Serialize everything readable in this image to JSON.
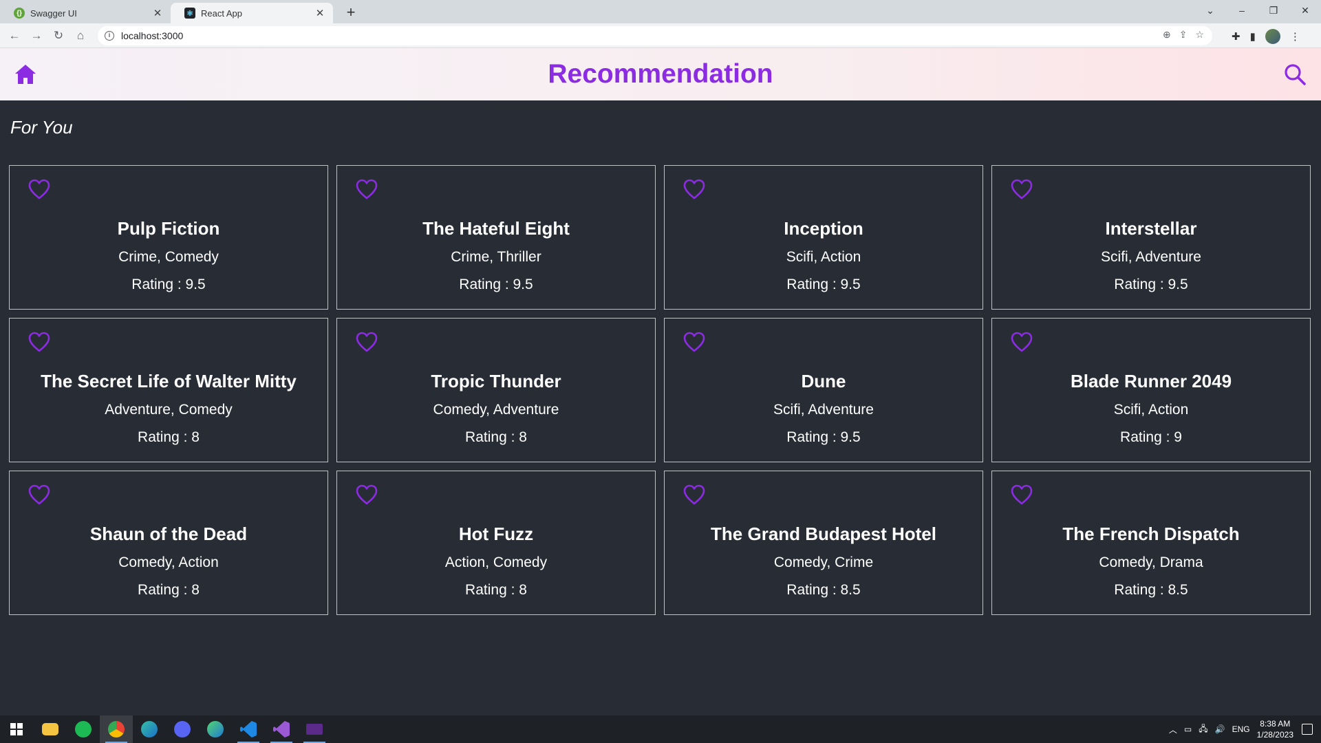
{
  "browser": {
    "tabs": [
      {
        "title": "Swagger UI",
        "active": false
      },
      {
        "title": "React App",
        "active": true
      }
    ],
    "new_tab_label": "+",
    "address": "localhost:3000",
    "window_controls": [
      "⌄",
      "–",
      "❐",
      "✕"
    ]
  },
  "app": {
    "title": "Recommendation",
    "accent_color": "#8b2be2",
    "section_title": "For You",
    "movies": [
      {
        "title": "Pulp Fiction",
        "genres": "Crime, Comedy",
        "rating": "Rating : 9.5"
      },
      {
        "title": "The Hateful Eight",
        "genres": "Crime, Thriller",
        "rating": "Rating : 9.5"
      },
      {
        "title": "Inception",
        "genres": "Scifi, Action",
        "rating": "Rating : 9.5"
      },
      {
        "title": "Interstellar",
        "genres": "Scifi, Adventure",
        "rating": "Rating : 9.5"
      },
      {
        "title": "The Secret Life of Walter Mitty",
        "genres": "Adventure, Comedy",
        "rating": "Rating : 8"
      },
      {
        "title": "Tropic Thunder",
        "genres": "Comedy, Adventure",
        "rating": "Rating : 8"
      },
      {
        "title": "Dune",
        "genres": "Scifi, Adventure",
        "rating": "Rating : 9.5"
      },
      {
        "title": "Blade Runner 2049",
        "genres": "Scifi, Action",
        "rating": "Rating : 9"
      },
      {
        "title": "Shaun of the Dead",
        "genres": "Comedy, Action",
        "rating": "Rating : 8"
      },
      {
        "title": "Hot Fuzz",
        "genres": "Action, Comedy",
        "rating": "Rating : 8"
      },
      {
        "title": "The Grand Budapest Hotel",
        "genres": "Comedy, Crime",
        "rating": "Rating : 8.5"
      },
      {
        "title": "The French Dispatch",
        "genres": "Comedy, Drama",
        "rating": "Rating : 8.5"
      }
    ]
  },
  "taskbar": {
    "language": "ENG",
    "time": "8:38 AM",
    "date": "1/28/2023"
  }
}
